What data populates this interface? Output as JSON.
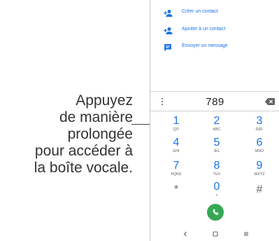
{
  "callout": {
    "lines": [
      "Appuyez",
      "de manière",
      "prolongée",
      "pour accéder à",
      "la boîte vocale."
    ]
  },
  "menu": {
    "items": [
      {
        "label": "Créer un contact",
        "icon": "add-person-icon"
      },
      {
        "label": "Ajouter à un contact",
        "icon": "add-person-icon"
      },
      {
        "label": "Envoyer un message",
        "icon": "message-icon"
      }
    ]
  },
  "dialer": {
    "number": "789",
    "keys": [
      {
        "digit": "1",
        "letters": "QO"
      },
      {
        "digit": "2",
        "letters": "ABC"
      },
      {
        "digit": "3",
        "letters": "DEF"
      },
      {
        "digit": "4",
        "letters": "GHI"
      },
      {
        "digit": "5",
        "letters": "JKL"
      },
      {
        "digit": "6",
        "letters": "MNO"
      },
      {
        "digit": "7",
        "letters": "PQRS"
      },
      {
        "digit": "8",
        "letters": "TUV"
      },
      {
        "digit": "9",
        "letters": "WXYZ"
      },
      {
        "digit": "*",
        "letters": ""
      },
      {
        "digit": "0",
        "letters": "+"
      },
      {
        "digit": "#",
        "letters": ""
      }
    ]
  },
  "colors": {
    "accent": "#1a73e8",
    "call": "#34a853"
  }
}
